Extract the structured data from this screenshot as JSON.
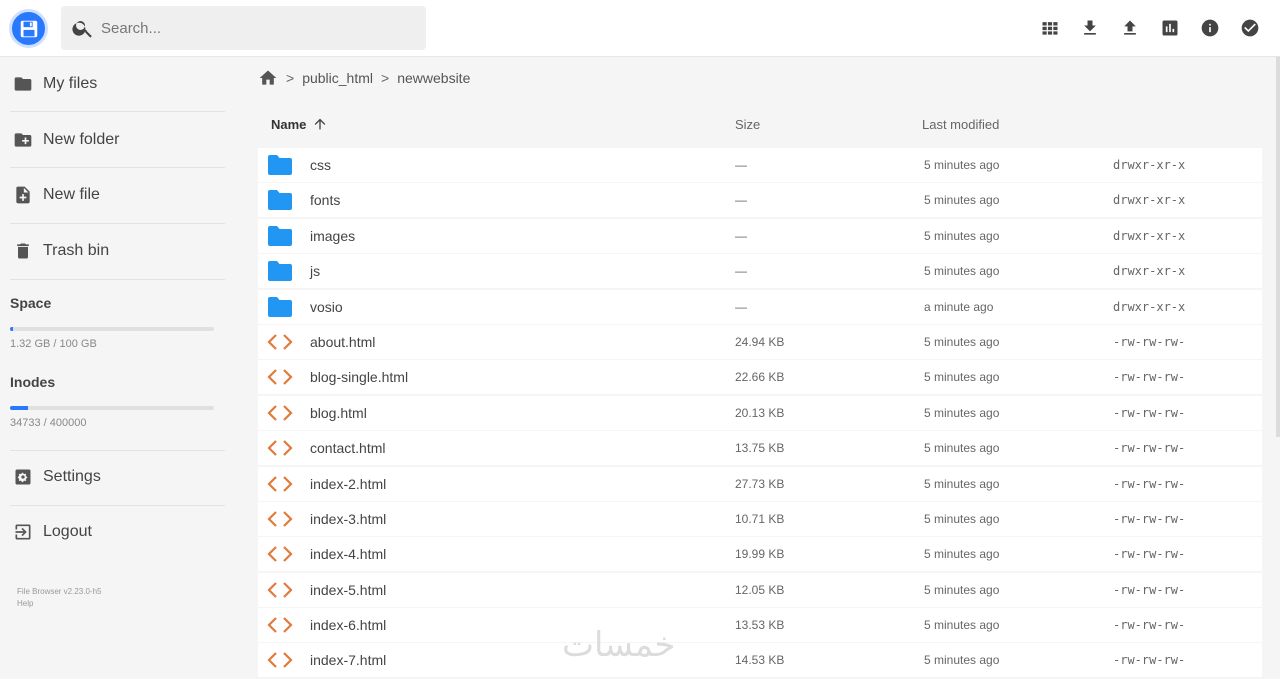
{
  "header": {
    "search_placeholder": "Search...",
    "toolbar": [
      {
        "name": "grid-view-icon"
      },
      {
        "name": "download-icon"
      },
      {
        "name": "upload-icon"
      },
      {
        "name": "info-chart-icon"
      },
      {
        "name": "info-icon"
      },
      {
        "name": "check-circle-icon"
      }
    ]
  },
  "sidebar": {
    "items": [
      {
        "label": "My files",
        "icon": "folder-icon"
      },
      {
        "label": "New folder",
        "icon": "create-new-folder-icon"
      },
      {
        "label": "New file",
        "icon": "note-add-icon"
      },
      {
        "label": "Trash bin",
        "icon": "trash-icon"
      }
    ],
    "space": {
      "title": "Space",
      "text": "1.32 GB / 100 GB",
      "percent": 1.3
    },
    "inodes": {
      "title": "Inodes",
      "text": "34733 / 400000",
      "percent": 8.7
    },
    "settings_label": "Settings",
    "logout_label": "Logout",
    "credits_version": "File Browser v2.23.0-h5",
    "credits_help": "Help"
  },
  "breadcrumb": {
    "items": [
      "public_html",
      "newwebsite"
    ]
  },
  "columns": {
    "name": "Name",
    "size": "Size",
    "modified": "Last modified"
  },
  "files": [
    {
      "name": "css",
      "size": "—",
      "modified": "5 minutes ago",
      "perm": "drwxr-xr-x",
      "type": "folder"
    },
    {
      "name": "fonts",
      "size": "—",
      "modified": "5 minutes ago",
      "perm": "drwxr-xr-x",
      "type": "folder"
    },
    {
      "name": "images",
      "size": "—",
      "modified": "5 minutes ago",
      "perm": "drwxr-xr-x",
      "type": "folder"
    },
    {
      "name": "js",
      "size": "—",
      "modified": "5 minutes ago",
      "perm": "drwxr-xr-x",
      "type": "folder"
    },
    {
      "name": "vosio",
      "size": "—",
      "modified": "a minute ago",
      "perm": "drwxr-xr-x",
      "type": "folder"
    },
    {
      "name": "about.html",
      "size": "24.94 KB",
      "modified": "5 minutes ago",
      "perm": "-rw-rw-rw-",
      "type": "code"
    },
    {
      "name": "blog-single.html",
      "size": "22.66 KB",
      "modified": "5 minutes ago",
      "perm": "-rw-rw-rw-",
      "type": "code"
    },
    {
      "name": "blog.html",
      "size": "20.13 KB",
      "modified": "5 minutes ago",
      "perm": "-rw-rw-rw-",
      "type": "code"
    },
    {
      "name": "contact.html",
      "size": "13.75 KB",
      "modified": "5 minutes ago",
      "perm": "-rw-rw-rw-",
      "type": "code"
    },
    {
      "name": "index-2.html",
      "size": "27.73 KB",
      "modified": "5 minutes ago",
      "perm": "-rw-rw-rw-",
      "type": "code"
    },
    {
      "name": "index-3.html",
      "size": "10.71 KB",
      "modified": "5 minutes ago",
      "perm": "-rw-rw-rw-",
      "type": "code"
    },
    {
      "name": "index-4.html",
      "size": "19.99 KB",
      "modified": "5 minutes ago",
      "perm": "-rw-rw-rw-",
      "type": "code"
    },
    {
      "name": "index-5.html",
      "size": "12.05 KB",
      "modified": "5 minutes ago",
      "perm": "-rw-rw-rw-",
      "type": "code"
    },
    {
      "name": "index-6.html",
      "size": "13.53 KB",
      "modified": "5 minutes ago",
      "perm": "-rw-rw-rw-",
      "type": "code"
    },
    {
      "name": "index-7.html",
      "size": "14.53 KB",
      "modified": "5 minutes ago",
      "perm": "-rw-rw-rw-",
      "type": "code"
    }
  ],
  "colors": {
    "accent": "#2979ff",
    "folder": "#2196f3",
    "code": "#e07b3c"
  },
  "watermark": "خمسات"
}
